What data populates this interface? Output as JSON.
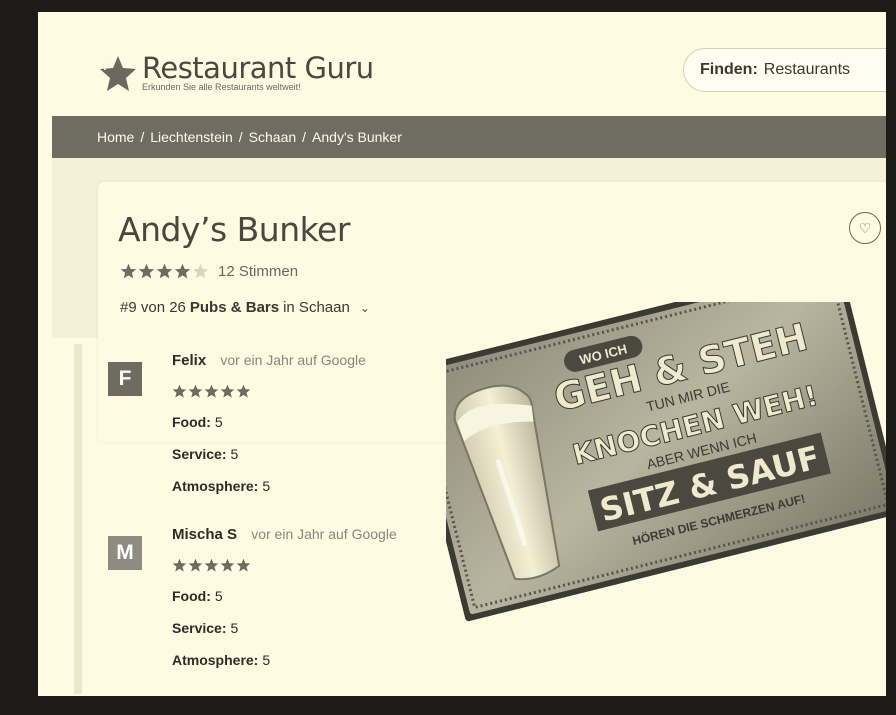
{
  "header": {
    "logo_title": "Restaurant Guru",
    "logo_subtitle": "Erkunden Sie alle Restaurants weltweit!",
    "finder_label": "Finden:",
    "finder_value": "Restaurants"
  },
  "breadcrumb": {
    "items": [
      "Home",
      "Liechtenstein",
      "Schaan",
      "Andy's Bunker"
    ],
    "separator": "/"
  },
  "restaurant": {
    "name": "Andy’s Bunker",
    "rating_fraction": 0.8,
    "votes": "12 Stimmen",
    "rank_prefix": "#9 von 26",
    "rank_category": "Pubs & Bars",
    "rank_suffix": "in Schaan"
  },
  "reviews": [
    {
      "initial": "F",
      "avatar_color": "#6e6b61",
      "author": "Felix",
      "meta": "vor ein Jahr auf Google",
      "stars": 5,
      "food_label": "Food:",
      "food": "5",
      "service_label": "Service:",
      "service": "5",
      "atmosphere_label": "Atmosphere:",
      "atmosphere": "5"
    },
    {
      "initial": "M",
      "avatar_color": "#8e8b80",
      "author": "Mischa S",
      "meta": "vor ein Jahr auf Google",
      "stars": 5,
      "food_label": "Food:",
      "food": "5",
      "service_label": "Service:",
      "service": "5",
      "atmosphere_label": "Atmosphere:",
      "atmosphere": "5"
    }
  ],
  "sign": {
    "line1": "WO ICH",
    "line2": "GEH & STEH",
    "line3": "TUN MIR DIE",
    "line4": "KNOCHEN WEH!",
    "line5": "ABER WENN ICH",
    "line6": "SITZ & SAUF",
    "line7": "HÖREN DIE SCHMERZEN AUF!"
  },
  "colors": {
    "page_bg": "#fefbe2",
    "breadcrumb_bg": "#6f6c62",
    "text_dark": "#3a3830",
    "star": "#6e6b61"
  }
}
